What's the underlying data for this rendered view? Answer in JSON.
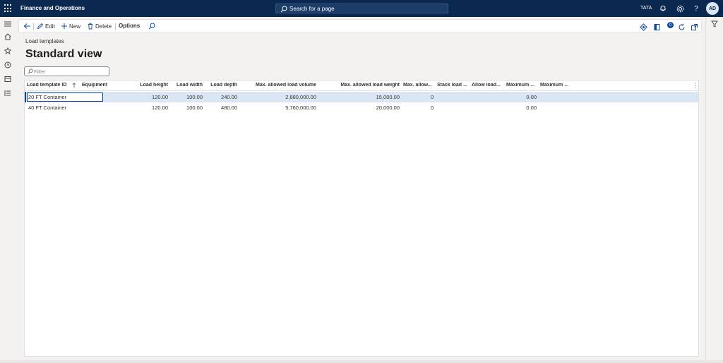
{
  "topbar": {
    "app_title": "Finance and Operations",
    "search_label": "Search for a page",
    "company": "TATA",
    "avatar_initials": "AD",
    "bg_color": "#0b2950"
  },
  "actions": {
    "edit": "Edit",
    "new": "New",
    "delete": "Delete",
    "options": "Options",
    "notification_count": "0"
  },
  "page": {
    "breadcrumb": "Load templates",
    "view_title": "Standard view",
    "filter_placeholder": "Filter"
  },
  "grid": {
    "columns": [
      "Load template ID",
      "Equipment",
      "Load height",
      "Load width",
      "Load depth",
      "Max. allowed load volume",
      "Max. allowed load weight",
      "Max. allow...",
      "Stack load ...",
      "Allow load...",
      "Maximum ...",
      "Maximum ..."
    ],
    "rows": [
      {
        "id": "20 FT Container",
        "equipment": "",
        "height": "120.00",
        "width": "100.00",
        "depth": "240.00",
        "max_volume": "2,880,000.00",
        "max_weight": "15,000.00",
        "max_allow": "0",
        "max_a": "0.00"
      },
      {
        "id": "40 FT Container",
        "equipment": "",
        "height": "120.00",
        "width": "100.00",
        "depth": "480.00",
        "max_volume": "5,760,000.00",
        "max_weight": "20,000.00",
        "max_allow": "0",
        "max_a": "0.00"
      }
    ],
    "selected_row": 0
  },
  "colors": {
    "accent": "#0b4aa2",
    "selected_row": "#dbe6f4"
  }
}
